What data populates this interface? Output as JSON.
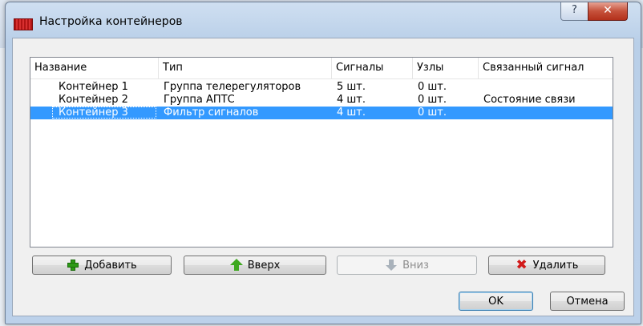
{
  "window": {
    "title": "Настройка контейнеров",
    "help_glyph": "?",
    "close_glyph": "✕"
  },
  "table": {
    "columns": [
      "Название",
      "Тип",
      "Сигналы",
      "Узлы",
      "Связанный сигнал"
    ],
    "rows": [
      {
        "name": "Контейнер 1",
        "type": "Группа телерегуляторов",
        "signals": "5 шт.",
        "nodes": "0 шт.",
        "linked": ""
      },
      {
        "name": "Контейнер 2",
        "type": "Группа АПТС",
        "signals": "4 шт.",
        "nodes": "0 шт.",
        "linked": "Состояние связи"
      },
      {
        "name": "Контейнер 3",
        "type": "Фильтр сигналов",
        "signals": "4 шт.",
        "nodes": "0 шт.",
        "linked": ""
      }
    ],
    "selected_index": 2
  },
  "buttons": {
    "add": "Добавить",
    "up": "Вверх",
    "down": "Вниз",
    "delete": "Удалить",
    "ok": "OK",
    "cancel": "Отмена"
  },
  "icons": {
    "add": "plus-icon",
    "up": "arrow-up-icon",
    "down": "arrow-down-icon",
    "delete": "red-x-icon",
    "app": "app-icon"
  },
  "colors": {
    "selection": "#3399ff",
    "add_icon": "#2d9a17",
    "delete_icon": "#d21a1a"
  }
}
